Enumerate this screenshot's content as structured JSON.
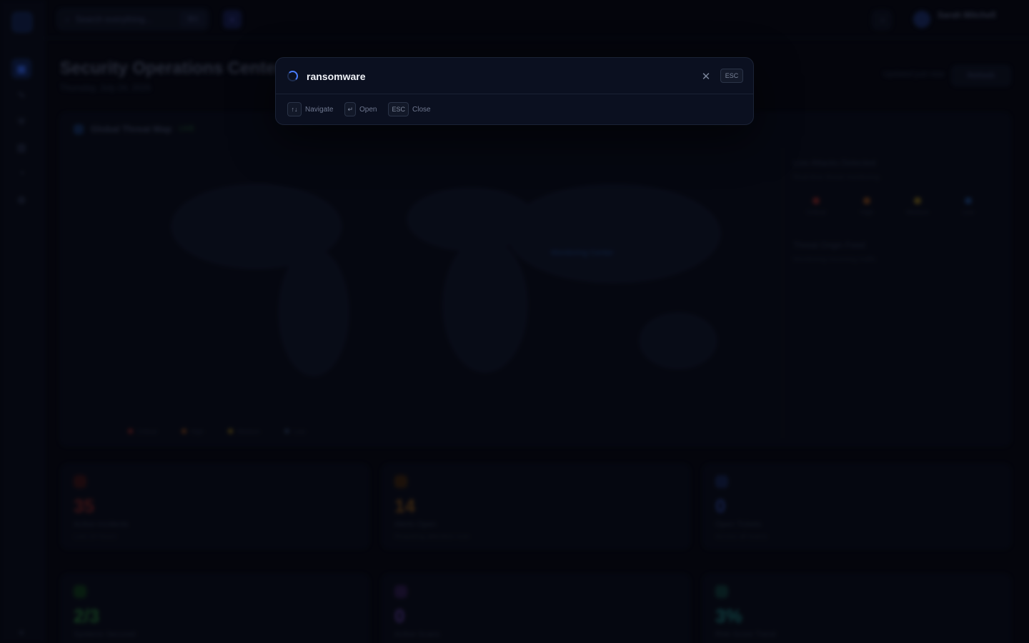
{
  "background": {
    "sidebar_icons": [
      "grid-icon",
      "activity-icon",
      "shield-icon",
      "chart-icon",
      "bell-icon",
      "gear-icon"
    ],
    "topbar": {
      "search_placeholder": "Search everything...",
      "search_shortcut": "⌘K",
      "user_name": "Sarah Mitchell"
    },
    "page": {
      "title": "Security Operations Center",
      "date": "Thursday, July 24, 2025",
      "refresh_text": "Updated just now",
      "refresh_label": "Refresh"
    },
    "map": {
      "title": "Global Threat Map",
      "live_badge": "LIVE",
      "side_title": "Live Attacks Detected",
      "side_subtitle": "Real-time threat monitoring",
      "severities": [
        {
          "label": "Critical",
          "color": "#5a1c1c"
        },
        {
          "label": "High",
          "color": "#5a3214"
        },
        {
          "label": "Medium",
          "color": "#5a4a14"
        },
        {
          "label": "Low",
          "color": "#14305a"
        }
      ],
      "side_title2": "Threat Origin Feed",
      "side_subtitle2": "Monitoring incoming traffic",
      "legend": [
        {
          "label": "Critical",
          "color": "#5a1c1c"
        },
        {
          "label": "High",
          "color": "#5a3214"
        },
        {
          "label": "Medium",
          "color": "#5a4a14"
        },
        {
          "label": "Low",
          "color": "#1d2a40"
        }
      ],
      "hub_label": "Monitoring Center"
    },
    "stats": [
      {
        "value": "35",
        "label": "Active Incidents",
        "sub": "Last 24 hours",
        "color": "#6a1e1e"
      },
      {
        "value": "14",
        "label": "Alerts Open",
        "sub": "Requiring attention now",
        "color": "#6a4216"
      },
      {
        "value": "0",
        "label": "Open Tickets",
        "sub": "Across all teams",
        "color": "#1d2f6a"
      },
      {
        "value": "2/3",
        "label": "Systems Secured",
        "sub": "Endpoints online",
        "color": "#1d5a2a"
      },
      {
        "value": "0",
        "label": "Active Scans",
        "sub": "Running now",
        "color": "#3e2a6a"
      },
      {
        "value": "3%",
        "label": "Risk Score Trend",
        "sub": "vs last week",
        "color": "#155a5a"
      }
    ]
  },
  "palette": {
    "query": "ransomware",
    "esc_badge": "ESC",
    "hints": [
      {
        "key": "↑↓",
        "label": "Navigate"
      },
      {
        "key": "↵",
        "label": "Open"
      },
      {
        "key": "ESC",
        "label": "Close"
      }
    ]
  }
}
